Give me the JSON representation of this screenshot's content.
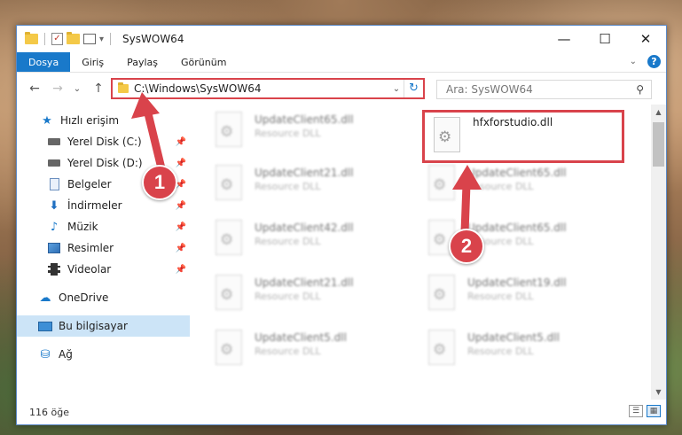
{
  "window": {
    "title": "SysWOW64",
    "controls": {
      "minimize": "—",
      "maximize": "☐",
      "close": "✕"
    }
  },
  "ribbon": {
    "tabs": [
      {
        "label": "Dosya",
        "active": true
      },
      {
        "label": "Giriş"
      },
      {
        "label": "Paylaş"
      },
      {
        "label": "Görünüm"
      }
    ],
    "help": "?"
  },
  "navbar": {
    "back": "←",
    "forward": "→",
    "recent": "⌄",
    "up": "↑",
    "address": "C:\\Windows\\SysWOW64",
    "refresh": "↻",
    "search_placeholder": "Ara: SysWOW64"
  },
  "sidebar": {
    "items": [
      {
        "label": "Hızlı erişim",
        "icon": "star-icon"
      },
      {
        "label": "Yerel Disk (C:)",
        "icon": "disk-icon",
        "pinned": true
      },
      {
        "label": "Yerel Disk (D:)",
        "icon": "disk-icon",
        "pinned": true
      },
      {
        "label": "Belgeler",
        "icon": "documents-icon",
        "pinned": true
      },
      {
        "label": "İndirmeler",
        "icon": "download-icon",
        "pinned": true
      },
      {
        "label": "Müzik",
        "icon": "music-icon",
        "pinned": true
      },
      {
        "label": "Resimler",
        "icon": "pictures-icon",
        "pinned": true
      },
      {
        "label": "Videolar",
        "icon": "videos-icon",
        "pinned": true
      },
      {
        "label": "OneDrive",
        "icon": "cloud-icon"
      },
      {
        "label": "Bu bilgisayar",
        "icon": "computer-icon",
        "selected": true
      },
      {
        "label": "Ağ",
        "icon": "network-icon"
      }
    ]
  },
  "files": [
    {
      "name": "UpdateClient65.dll",
      "type": "Resource DLL"
    },
    {
      "name": "hfxforstudio.dll",
      "type": ""
    },
    {
      "name": "UpdateClient21.dll",
      "type": "Resource DLL"
    },
    {
      "name": "UpdateClient65.dll",
      "type": "Resource DLL"
    },
    {
      "name": "UpdateClient42.dll",
      "type": "Resource DLL"
    },
    {
      "name": "UpdateClient65.dll",
      "type": "Resource DLL"
    },
    {
      "name": "UpdateClient21.dll",
      "type": "Resource DLL"
    },
    {
      "name": "UpdateClient19.dll",
      "type": "Resource DLL"
    },
    {
      "name": "UpdateClient5.dll",
      "type": "Resource DLL"
    },
    {
      "name": "UpdateClient5.dll",
      "type": "Resource DLL"
    }
  ],
  "status": {
    "count": "116 öğe"
  },
  "annotations": {
    "step1": "1",
    "step2": "2",
    "color": "#d9434b"
  }
}
